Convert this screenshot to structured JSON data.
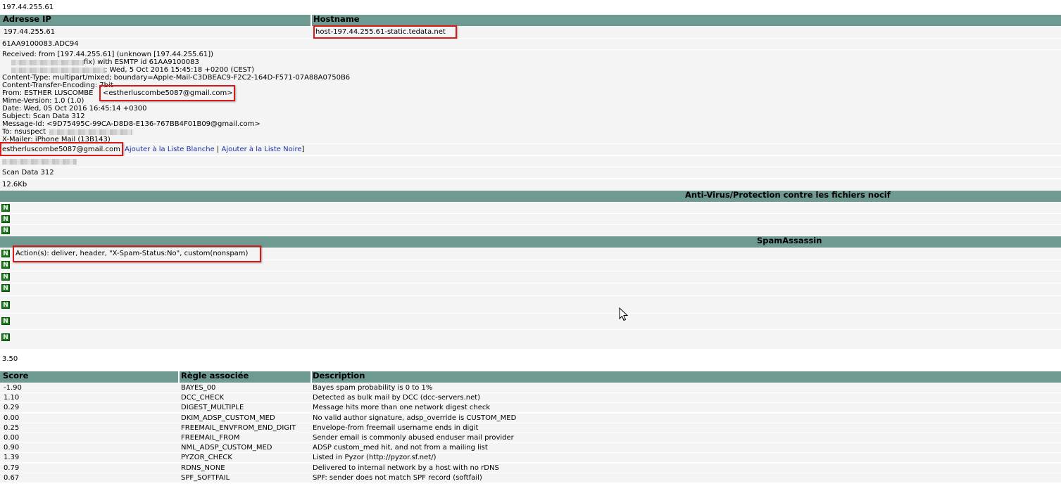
{
  "top_ip": "197.44.255.61",
  "ip_table": {
    "headers": [
      "Adresse IP",
      "Hostname"
    ],
    "ip": "197.44.255.61",
    "hostname": "host-197.44.255.61-static.tedata.net"
  },
  "message_id": "61AA9100083.ADC94",
  "headers_block": {
    "received_1": "Received: from [197.44.255.61] (unknown [197.44.255.61])",
    "received_2": "fix) with ESMTP id 61AA9100083",
    "received_3": "; Wed, 5 Oct 2016 15:45:18 +0200 (CEST)",
    "content_type": "Content-Type: multipart/mixed; boundary=Apple-Mail-C3DBEAC9-F2C2-164D-F571-07A88A0750B6",
    "cte": "Content-Transfer-Encoding: 7bit",
    "from_prefix": "From: ESTHER LUSCOMBE",
    "from_addr": "<estherluscombe5087@gmail.com>",
    "mime": "Mime-Version: 1.0 (1.0)",
    "date": "Date: Wed, 05 Oct 2016 16:45:14 +0300",
    "subject": "Subject: Scan Data 312",
    "msgid": "Message-Id: <9D75495C-99CA-D8D8-E136-767BB4F01B09@gmail.com>",
    "to": "To: nsuspect",
    "xmailer": "X-Mailer: iPhone Mail (13B143)"
  },
  "sender": {
    "address": "estherluscombe5087@gmail.com",
    "whitelist": "Ajouter à la Liste Blanche",
    "sep": "|",
    "blacklist": "Ajouter à la Liste Noire",
    "close": "]"
  },
  "subject_value": "Scan Data 312",
  "size": "12.6Kb",
  "antivirus_header": "Anti-Virus/Protection contre les fichiers nocif",
  "spam_header": "SpamAssassin",
  "badge": "N",
  "action": "Action(s): deliver, header, \"X-Spam-Status:No\", custom(nonspam)",
  "spam_score": "3.50",
  "score_table": {
    "headers": [
      "Score",
      "Règle associée",
      "Description"
    ],
    "rows": [
      [
        "-1.90",
        "BAYES_00",
        "Bayes spam probability is 0 to 1%"
      ],
      [
        "1.10",
        "DCC_CHECK",
        "Detected as bulk mail by DCC (dcc-servers.net)"
      ],
      [
        "0.29",
        "DIGEST_MULTIPLE",
        "Message hits more than one network digest check"
      ],
      [
        "0.00",
        "DKIM_ADSP_CUSTOM_MED",
        "No valid author signature, adsp_override is CUSTOM_MED"
      ],
      [
        "0.25",
        "FREEMAIL_ENVFROM_END_DIGIT",
        "Envelope-from freemail username ends in digit"
      ],
      [
        "0.00",
        "FREEMAIL_FROM",
        "Sender email is commonly abused enduser mail provider"
      ],
      [
        "0.90",
        "NML_ADSP_CUSTOM_MED",
        "ADSP custom_med hit, and not from a mailing list"
      ],
      [
        "1.39",
        "PYZOR_CHECK",
        "Listed in Pyzor (http://pyzor.sf.net/)"
      ],
      [
        "0.79",
        "RDNS_NONE",
        "Delivered to internal network by a host with no rDNS"
      ],
      [
        "0.67",
        "SPF_SOFTFAIL",
        "SPF: sender does not match SPF record (softfail)"
      ]
    ]
  },
  "colors": {
    "header_bg": "#6f9a92",
    "row_bg": "#f4f4f4",
    "highlight_border": "#d81a1a",
    "badge_green": "#1b7a1b",
    "link": "#1a33a6"
  }
}
